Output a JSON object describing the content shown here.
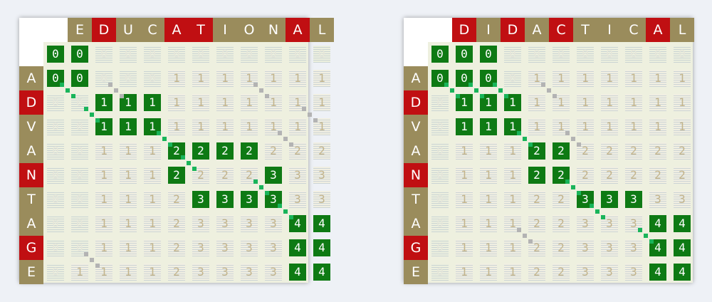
{
  "colors": {
    "match": "#c00f12",
    "neutral": "#9a8c5c",
    "highlight": "#0e7a14",
    "path": "#19b45a"
  },
  "panels": [
    {
      "id": "left",
      "top_word": [
        "E",
        "D",
        "U",
        "C",
        "A",
        "T",
        "I",
        "O",
        "N",
        "A",
        "L"
      ],
      "side_word": [
        "A",
        "D",
        "V",
        "A",
        "N",
        "T",
        "A",
        "G",
        "E"
      ],
      "matrix": [
        [
          "0",
          "0",
          "0",
          "0",
          "0",
          "0",
          "0",
          "0",
          "0",
          "0",
          "0",
          "0"
        ],
        [
          "0",
          "0",
          "0",
          "0",
          "0",
          "1",
          "1",
          "1",
          "1",
          "1",
          "1",
          "1"
        ],
        [
          "0",
          "0",
          "1",
          "1",
          "1",
          "1",
          "1",
          "1",
          "1",
          "1",
          "1",
          "1"
        ],
        [
          "0",
          "0",
          "1",
          "1",
          "1",
          "1",
          "1",
          "1",
          "1",
          "1",
          "1",
          "1"
        ],
        [
          "0",
          "0",
          "1",
          "1",
          "1",
          "2",
          "2",
          "2",
          "2",
          "2",
          "2",
          "2"
        ],
        [
          "0",
          "0",
          "1",
          "1",
          "1",
          "2",
          "2",
          "2",
          "2",
          "3",
          "3",
          "3"
        ],
        [
          "0",
          "0",
          "1",
          "1",
          "1",
          "2",
          "3",
          "3",
          "3",
          "3",
          "3",
          "3"
        ],
        [
          "0",
          "0",
          "1",
          "1",
          "1",
          "2",
          "3",
          "3",
          "3",
          "3",
          "4",
          "4"
        ],
        [
          "0",
          "0",
          "1",
          "1",
          "1",
          "2",
          "3",
          "3",
          "3",
          "3",
          "4",
          "4"
        ],
        [
          "0",
          "1",
          "1",
          "1",
          "1",
          "2",
          "3",
          "3",
          "3",
          "3",
          "4",
          "4"
        ]
      ]
    },
    {
      "id": "right",
      "top_word": [
        "D",
        "I",
        "D",
        "A",
        "C",
        "T",
        "I",
        "C",
        "A",
        "L"
      ],
      "side_word": [
        "A",
        "D",
        "V",
        "A",
        "N",
        "T",
        "A",
        "G",
        "E"
      ],
      "matrix": [
        [
          "0",
          "0",
          "0",
          "0",
          "0",
          "0",
          "0",
          "0",
          "0",
          "0",
          "0"
        ],
        [
          "0",
          "0",
          "0",
          "0",
          "1",
          "1",
          "1",
          "1",
          "1",
          "1",
          "1"
        ],
        [
          "0",
          "1",
          "1",
          "1",
          "1",
          "1",
          "1",
          "1",
          "1",
          "1",
          "1"
        ],
        [
          "0",
          "1",
          "1",
          "1",
          "1",
          "1",
          "1",
          "1",
          "1",
          "1",
          "1"
        ],
        [
          "0",
          "1",
          "1",
          "1",
          "2",
          "2",
          "2",
          "2",
          "2",
          "2",
          "2"
        ],
        [
          "0",
          "1",
          "1",
          "1",
          "2",
          "2",
          "2",
          "2",
          "2",
          "2",
          "2"
        ],
        [
          "0",
          "1",
          "1",
          "1",
          "2",
          "2",
          "3",
          "3",
          "3",
          "3",
          "3"
        ],
        [
          "0",
          "1",
          "1",
          "1",
          "2",
          "2",
          "3",
          "3",
          "3",
          "4",
          "4"
        ],
        [
          "0",
          "1",
          "1",
          "1",
          "2",
          "2",
          "3",
          "3",
          "3",
          "4",
          "4"
        ],
        [
          "0",
          "1",
          "1",
          "1",
          "2",
          "2",
          "3",
          "3",
          "3",
          "4",
          "4"
        ]
      ]
    }
  ]
}
